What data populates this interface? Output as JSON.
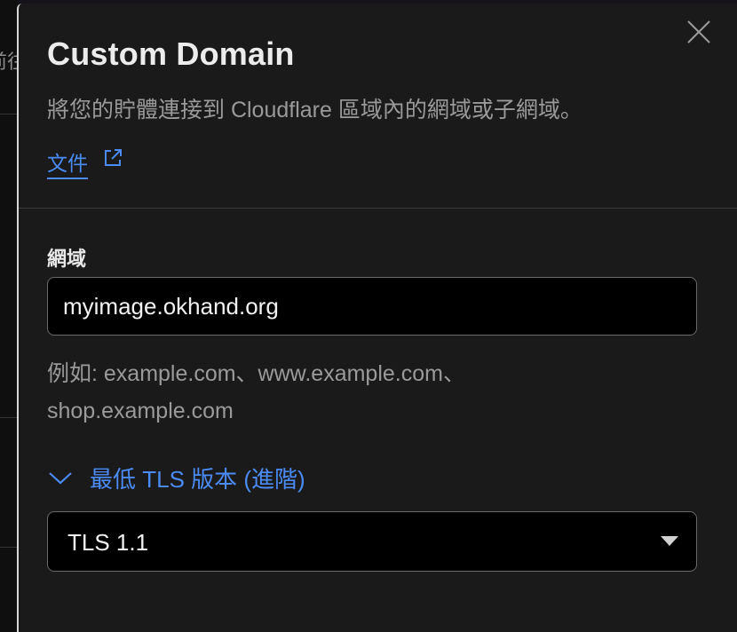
{
  "background": {
    "partial_text": "前往"
  },
  "dialog": {
    "title": "Custom Domain",
    "subtitle": "將您的貯體連接到 Cloudflare 區域內的網域或子網域。",
    "doc_link_label": "文件",
    "close_icon": "close-icon",
    "external_icon": "external-link-icon"
  },
  "domain_field": {
    "label": "網域",
    "value": "myimage.okhand.org",
    "hint_line1": "例如: example.com、www.example.com、",
    "hint_line2": "shop.example.com"
  },
  "tls": {
    "toggle_label": "最低 TLS 版本 (進階)",
    "selected_value": "TLS 1.1",
    "chevron_icon": "chevron-down-icon",
    "caret_icon": "caret-down-icon"
  },
  "colors": {
    "accent": "#4b8bf5",
    "panel_bg": "#1a1a1a",
    "input_bg": "#000000",
    "text_primary": "#ececec",
    "text_muted": "#9a9a9a"
  }
}
